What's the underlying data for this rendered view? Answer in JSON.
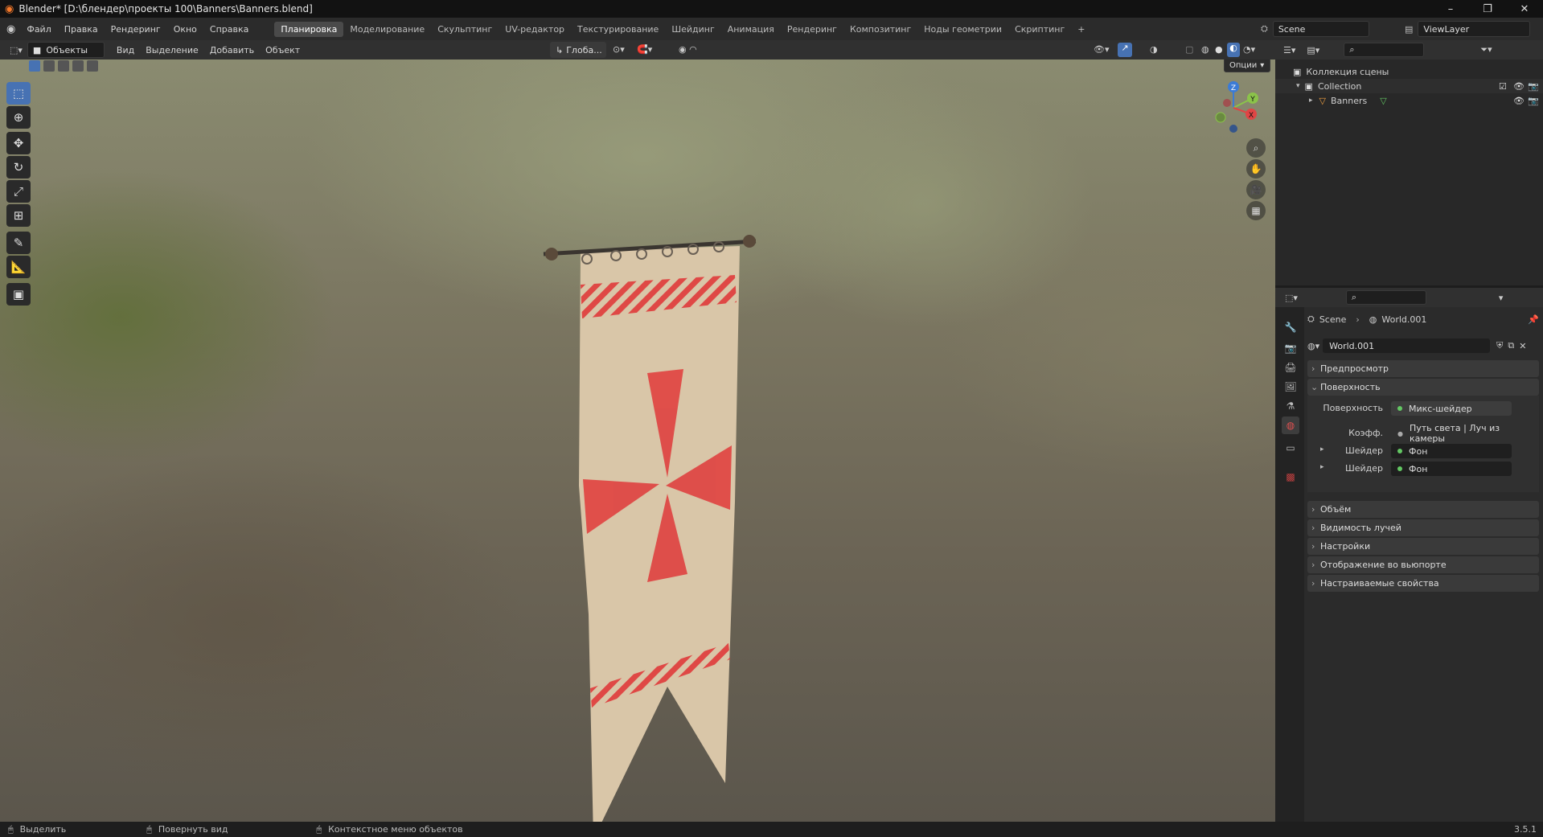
{
  "title": "Blender* [D:\\блендер\\проекты 100\\Banners\\Banners.blend]",
  "window_controls": [
    "–",
    "❐",
    "✕"
  ],
  "menu": [
    "Файл",
    "Правка",
    "Рендеринг",
    "Окно",
    "Справка"
  ],
  "workspaces": [
    "Планировка",
    "Моделирование",
    "Скульптинг",
    "UV-редактор",
    "Текстурирование",
    "Шейдинг",
    "Анимация",
    "Рендеринг",
    "Композитинг",
    "Ноды геометрии",
    "Скриптинг"
  ],
  "active_workspace": "Планировка",
  "add_workspace": "+",
  "scene": "Scene",
  "view_layer": "ViewLayer",
  "viewport_header": {
    "mode": "Объекты",
    "view": "Вид",
    "select": "Выделение",
    "add": "Добавить",
    "object": "Объект",
    "orientation": "Глоба...",
    "options": "Опции"
  },
  "gizmo": {
    "z": "Z",
    "y": "Y",
    "x": "X"
  },
  "outliner": {
    "scene_collection": "Коллекция сцены",
    "collection": "Collection",
    "object": "Banners"
  },
  "properties": {
    "breadcrumb_scene": "Scene",
    "breadcrumb_world": "World.001",
    "world_name": "World.001",
    "panels": {
      "preview": "Предпросмотр",
      "surface": "Поверхность"
    },
    "surface_label": "Поверхность",
    "surface_value": "Микс-шейдер",
    "fac_label": "Коэфф.",
    "fac_value": "Путь света | Луч из камеры",
    "shader1_label": "Шейдер",
    "shader1_value": "Фон",
    "shader2_label": "Шейдер",
    "shader2_value": "Фон",
    "more_panels": [
      "Объём",
      "Видимость лучей",
      "Настройки",
      "Отображение во вьюпорте",
      "Настраиваемые свойства"
    ]
  },
  "statusbar": {
    "select": "Выделить",
    "rotate": "Повернуть вид",
    "context": "Контекстное меню объектов",
    "version": "3.5.1"
  },
  "colors": {
    "accent": "#4772b3",
    "banner": "#d9c6a8",
    "banner_red": "#e03a3a",
    "green_dot": "#63c763"
  }
}
